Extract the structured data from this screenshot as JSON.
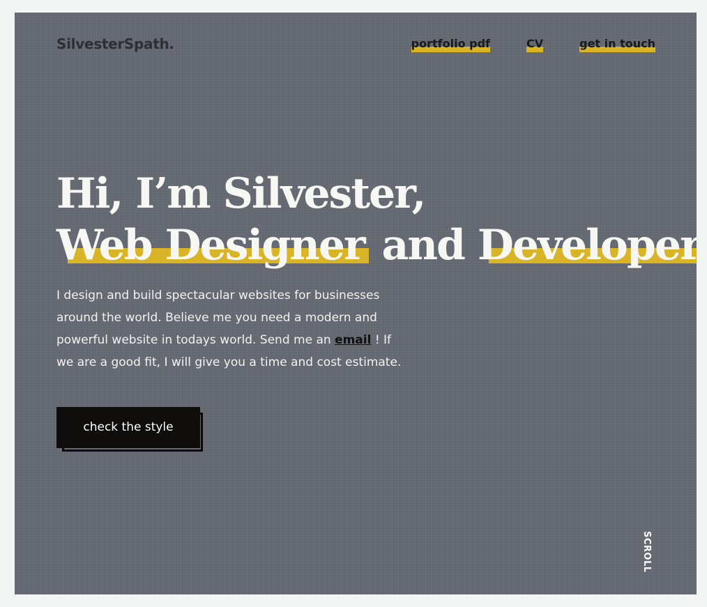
{
  "header": {
    "logo": "SilvesterSpath.",
    "nav": [
      {
        "label": "portfolio pdf"
      },
      {
        "label": "CV"
      },
      {
        "label": "get in touch"
      }
    ]
  },
  "hero": {
    "line1": "Hi, I’m Silvester,",
    "role1": "Web Designer",
    "connector": " and ",
    "role2": "Developer",
    "desc_before": "I design and build spectacular websites for businesses around the world. Believe me you need a modern and powerful website in todays world. Send me an ",
    "email_link": "email",
    "desc_after": " ! If we are a good fit, I will give you a time and cost estimate.",
    "cta": "check the style"
  },
  "scroll_label": "SCROLL",
  "colors": {
    "background": "#646870",
    "accent": "#d9b426",
    "text_light": "#f7f7f4",
    "text_dark": "#1a1a1a",
    "button": "#0f0c0c"
  }
}
